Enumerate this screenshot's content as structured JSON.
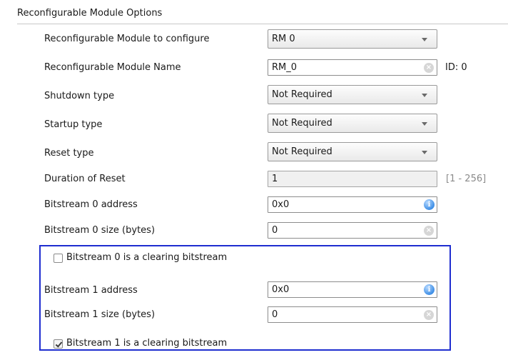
{
  "section": {
    "title": "Reconfigurable Module Options"
  },
  "rows": {
    "rm_to_configure": {
      "label": "Reconfigurable Module to configure",
      "value": "RM 0"
    },
    "rm_name": {
      "label": "Reconfigurable Module Name",
      "value": "RM_0",
      "id_text": "ID: 0"
    },
    "shutdown_type": {
      "label": "Shutdown type",
      "value": "Not Required"
    },
    "startup_type": {
      "label": "Startup type",
      "value": "Not Required"
    },
    "reset_type": {
      "label": "Reset type",
      "value": "Not Required"
    },
    "duration_of_reset": {
      "label": "Duration of Reset",
      "value": "1",
      "range": "[1 - 256]"
    },
    "bitstream0_address": {
      "label": "Bitstream 0 address",
      "value": "0x0"
    },
    "bitstream0_size": {
      "label": "Bitstream 0 size (bytes)",
      "value": "0"
    },
    "bitstream0_clearing": {
      "label": "Bitstream 0 is a clearing bitstream",
      "checked": false
    },
    "bitstream1_address": {
      "label": "Bitstream 1 address",
      "value": "0x0"
    },
    "bitstream1_size": {
      "label": "Bitstream 1 size (bytes)",
      "value": "0"
    },
    "bitstream1_clearing": {
      "label": "Bitstream 1 is a clearing bitstream",
      "checked": true
    }
  },
  "icons": {
    "clear": "clear-icon",
    "info": "info-icon",
    "dropdown": "chevron-down-icon"
  },
  "colors": {
    "highlight_box": "#1f2ed0",
    "info_icon": "#3f8fe6"
  }
}
